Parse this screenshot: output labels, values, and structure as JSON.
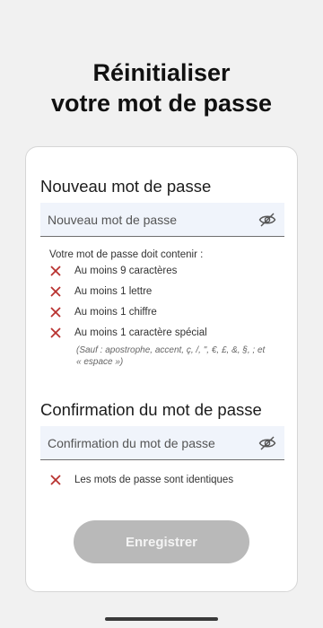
{
  "header": {
    "title_line1": "Réinitialiser",
    "title_line2": "votre mot de passe"
  },
  "new_password": {
    "label": "Nouveau mot de passe",
    "placeholder": "Nouveau mot de passe",
    "value": ""
  },
  "requirements": {
    "intro": "Votre mot de passe doit contenir :",
    "items": [
      {
        "label": "Au moins 9 caractères",
        "met": false
      },
      {
        "label": "Au moins 1 lettre",
        "met": false
      },
      {
        "label": "Au moins 1 chiffre",
        "met": false
      },
      {
        "label": "Au moins 1 caractère spécial",
        "met": false
      }
    ],
    "special_note_line1": "(Sauf : apostrophe, accent, ç, /, \", €, £, &, §, ; et",
    "special_note_line2": "« espace »)"
  },
  "confirm_password": {
    "label": "Confirmation du mot de passe",
    "placeholder": "Confirmation du mot de passe",
    "value": ""
  },
  "match_requirement": {
    "label": "Les mots de passe sont identiques",
    "met": false
  },
  "actions": {
    "save_label": "Enregistrer"
  },
  "colors": {
    "error_x": "#b8322f",
    "disabled_button": "#b9b9b9",
    "input_bg": "#f0f4fb"
  },
  "icons": {
    "visibility_toggle": "eye-slash-icon",
    "requirement_status": "cross-icon"
  }
}
